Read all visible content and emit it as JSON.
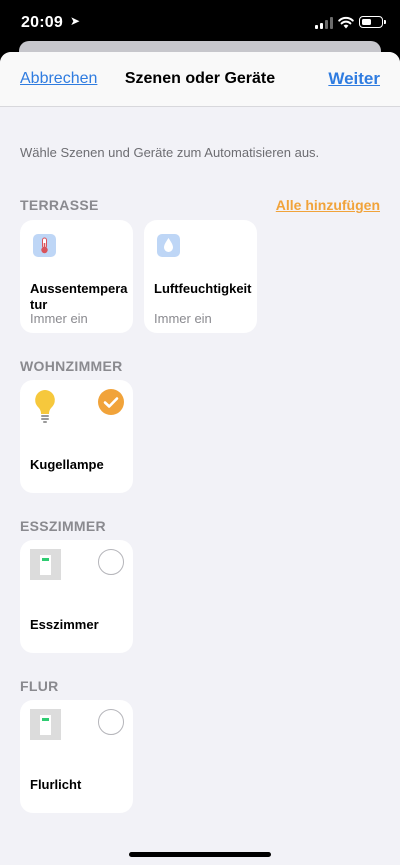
{
  "status_bar": {
    "time": "20:09",
    "location_glyph": "➤",
    "battery_percent": 55
  },
  "nav": {
    "cancel_label": "Abbrechen",
    "title": "Szenen oder Geräte",
    "next_label": "Weiter"
  },
  "instruction": "Wähle Szenen und Geräte zum Automatisieren aus.",
  "sections": {
    "terrasse": {
      "title": "TERRASSE",
      "add_all_label": "Alle hinzufügen",
      "tiles": [
        {
          "name": "Aussentemperatur",
          "status": "Immer ein",
          "icon": "thermometer-icon"
        },
        {
          "name": "Luftfeuchtigkeit",
          "status": "Immer ein",
          "icon": "humidity-icon"
        }
      ]
    },
    "wohnzimmer": {
      "title": "WOHNZIMMER",
      "tiles": [
        {
          "name": "Kugellampe",
          "selected": true,
          "icon": "lightbulb-icon"
        }
      ]
    },
    "esszimmer": {
      "title": "ESSZIMMER",
      "tiles": [
        {
          "name": "Esszimmer",
          "selected": false,
          "icon": "light-switch-icon"
        }
      ]
    },
    "flur": {
      "title": "FLUR",
      "tiles": [
        {
          "name": "Flurlicht",
          "selected": false,
          "icon": "light-switch-icon"
        }
      ]
    }
  },
  "colors": {
    "accent_blue": "#2f7ce0",
    "accent_orange": "#f1a33a",
    "background": "#f2f2f7"
  }
}
